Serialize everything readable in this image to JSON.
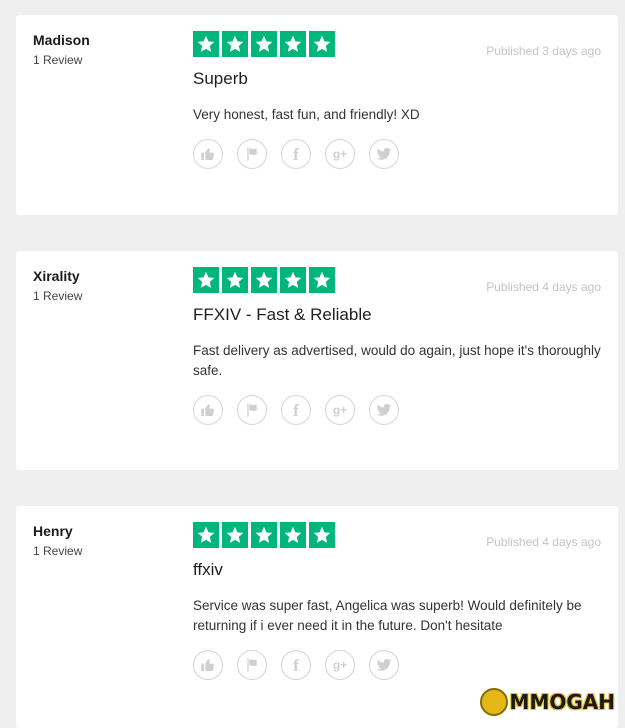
{
  "reviews": [
    {
      "name": "Madison",
      "review_count": "1 Review",
      "rating": 5,
      "published": "Published 3 days ago",
      "title": "Superb",
      "body": "Very honest, fast fun, and friendly! XD"
    },
    {
      "name": "Xirality",
      "review_count": "1 Review",
      "rating": 5,
      "published": "Published 4 days ago",
      "title": "FFXIV - Fast & Reliable",
      "body": "Fast delivery as advertised, would do again, just hope it's thoroughly safe."
    },
    {
      "name": "Henry",
      "review_count": "1 Review",
      "rating": 5,
      "published": "Published 4 days ago",
      "title": "ffxiv",
      "body": "Service was super fast, Angelica was superb! Would definitely be returning if i ever need it in the future. Don't hesitate"
    }
  ],
  "action_icons": [
    "thumbs-up-icon",
    "flag-icon",
    "facebook-icon",
    "google-plus-icon",
    "twitter-icon"
  ],
  "colors": {
    "star_green": "#00b67a",
    "page_bg": "#efefef",
    "card_bg": "#ffffff"
  },
  "watermark": "MMOGAH"
}
